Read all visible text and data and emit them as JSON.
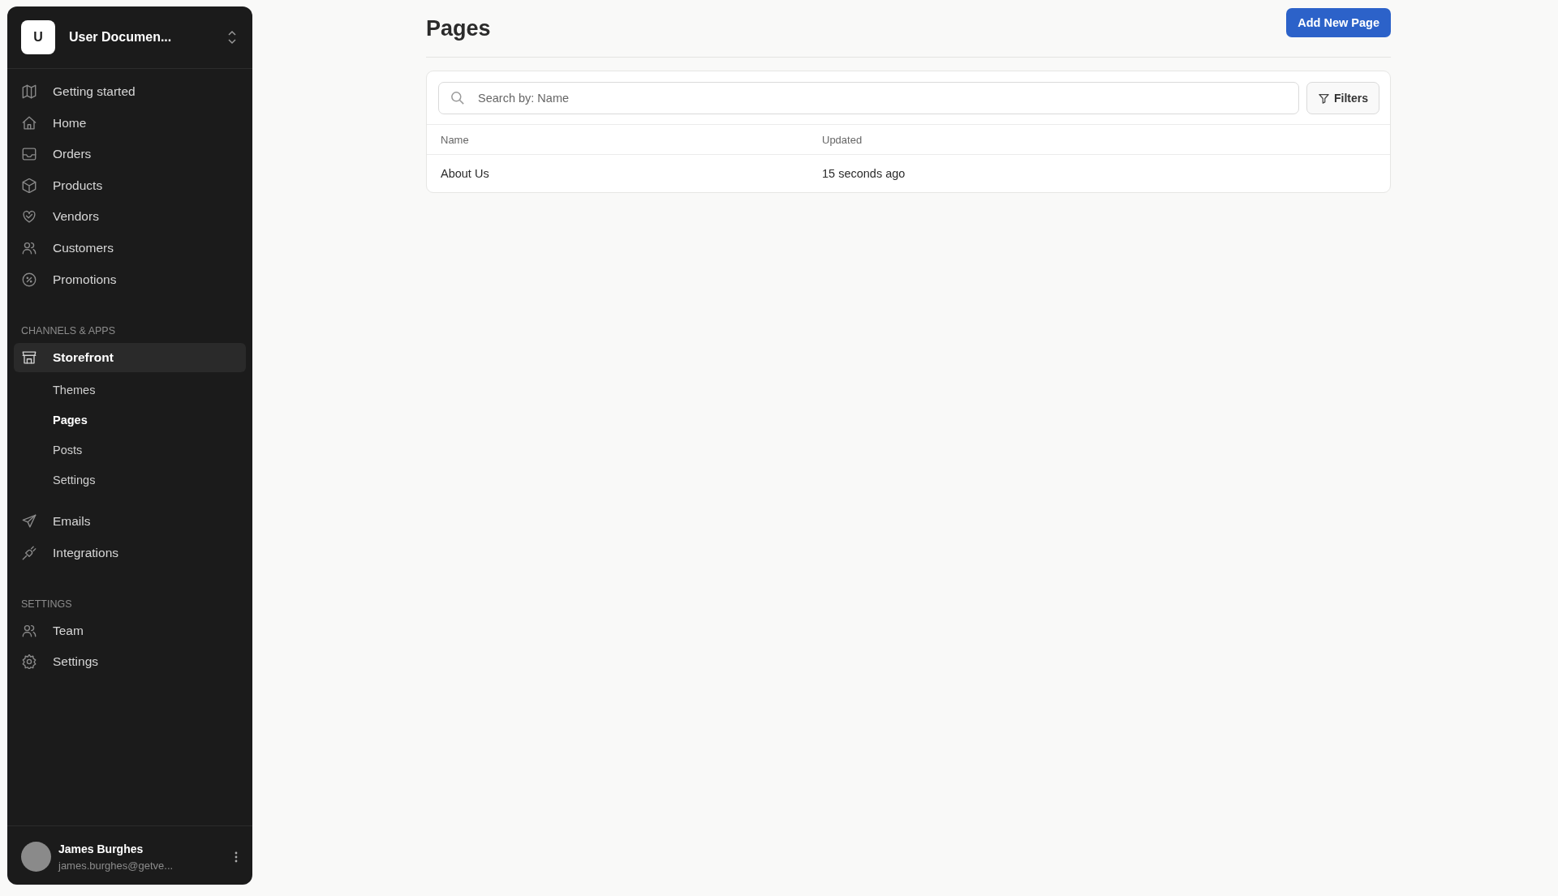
{
  "sidebar": {
    "workspace": {
      "initial": "U",
      "name": "User Documen..."
    },
    "sections": [
      {
        "items": [
          {
            "label": "Getting started",
            "selected": false
          },
          {
            "label": "Home",
            "selected": false
          },
          {
            "label": "Orders",
            "selected": false
          },
          {
            "label": "Products",
            "selected": false
          },
          {
            "label": "Vendors",
            "selected": false
          },
          {
            "label": "Customers",
            "selected": false
          },
          {
            "label": "Promotions",
            "selected": false
          }
        ]
      },
      {
        "title": "CHANNELS & APPS",
        "items": [
          {
            "label": "Storefront",
            "selected": true,
            "children": [
              {
                "label": "Themes",
                "selected": false
              },
              {
                "label": "Pages",
                "selected": true
              },
              {
                "label": "Posts",
                "selected": false
              },
              {
                "label": "Settings",
                "selected": false
              }
            ]
          },
          {
            "label": "Emails",
            "selected": false
          },
          {
            "label": "Integrations",
            "selected": false
          }
        ]
      },
      {
        "title": "SETTINGS",
        "items": [
          {
            "label": "Team",
            "selected": false
          },
          {
            "label": "Settings",
            "selected": false
          }
        ]
      }
    ],
    "user": {
      "name": "James Burghes",
      "email": "james.burghes@getve..."
    }
  },
  "main": {
    "title": "Pages",
    "add_button": "Add New Page",
    "search": {
      "placeholder": "Search by: Name"
    },
    "filters_button": "Filters",
    "table": {
      "columns": [
        "Name",
        "Updated"
      ],
      "rows": [
        [
          "About Us",
          "15 seconds ago"
        ]
      ]
    }
  }
}
